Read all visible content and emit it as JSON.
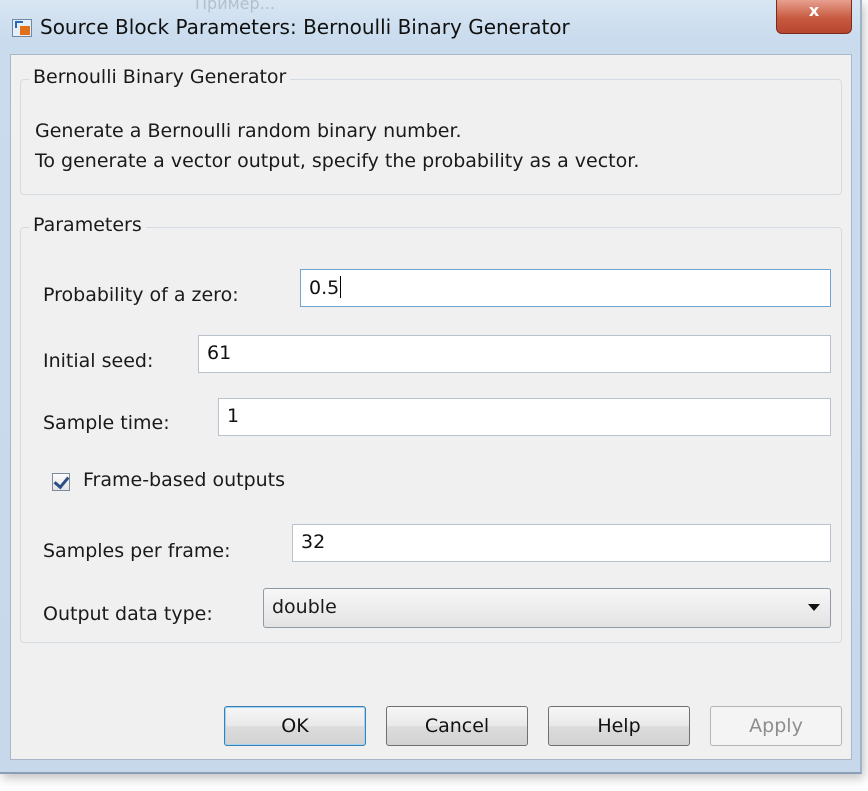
{
  "window": {
    "title": "Source Block Parameters: Bernoulli Binary Generator",
    "close_label": "x",
    "background_title_fragment": "Пример..."
  },
  "description_group": {
    "title": "Bernoulli Binary Generator",
    "line1": "Generate a Bernoulli random binary number.",
    "line2": "To generate a vector output, specify the probability as a vector."
  },
  "parameters": {
    "title": "Parameters",
    "prob_zero_label": "Probability of a zero:",
    "prob_zero_value": "0.5",
    "seed_label": "Initial seed:",
    "seed_value": "61",
    "sample_time_label": "Sample time:",
    "sample_time_value": "1",
    "frame_based_label": "Frame-based outputs",
    "frame_based_checked": true,
    "samples_per_frame_label": "Samples per frame:",
    "samples_per_frame_value": "32",
    "output_type_label": "Output data type:",
    "output_type_value": "double"
  },
  "buttons": {
    "ok": "OK",
    "cancel": "Cancel",
    "help": "Help",
    "apply": "Apply"
  },
  "colors": {
    "title_bar": "#c9dbed",
    "client_bg": "#f0f0f0",
    "close_button": "#c75a40",
    "default_button_border": "#3c7fb1"
  }
}
